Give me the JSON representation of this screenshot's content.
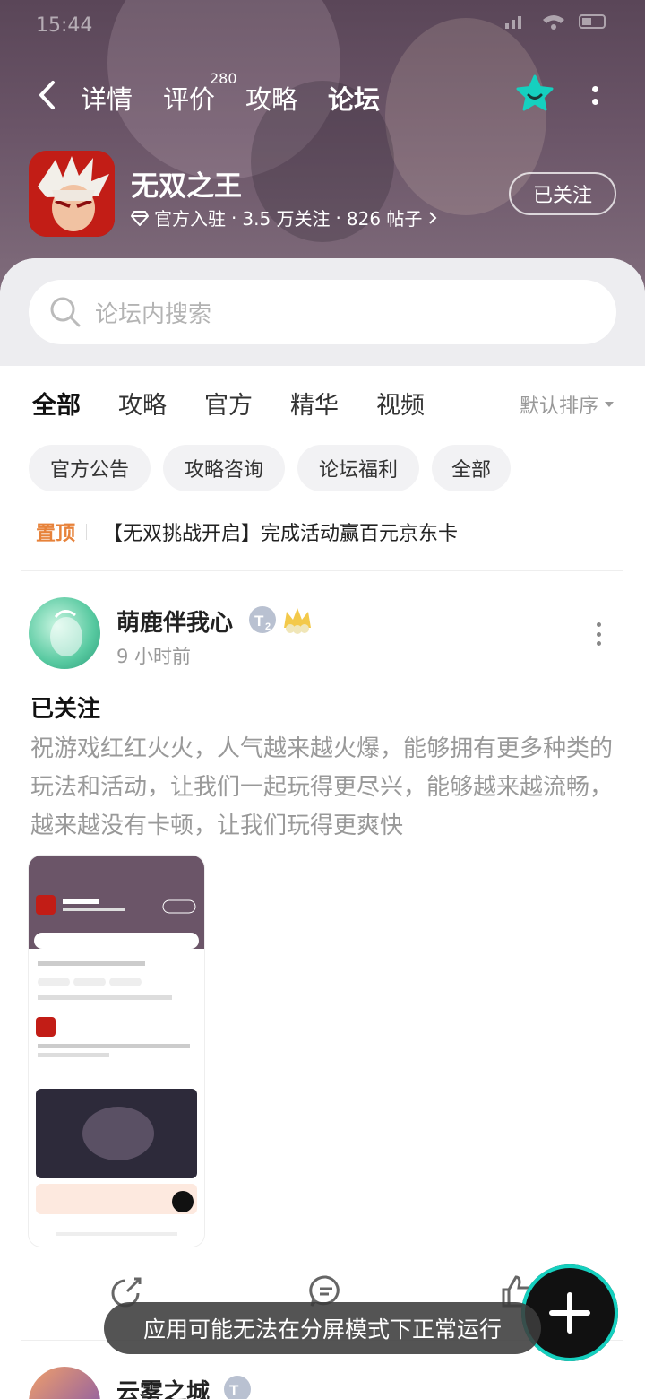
{
  "status_bar": {
    "time": "15:44"
  },
  "nav": {
    "tabs": [
      {
        "label": "详情"
      },
      {
        "label": "评价",
        "badge": "280"
      },
      {
        "label": "攻略"
      },
      {
        "label": "论坛"
      }
    ]
  },
  "game": {
    "name": "无双之王",
    "verified": "官方入驻",
    "followers": "3.5 万关注",
    "posts": "826 帖子",
    "separator": "·",
    "follow_button": "已关注"
  },
  "search": {
    "placeholder": "论坛内搜索"
  },
  "filter_tabs": [
    {
      "label": "全部"
    },
    {
      "label": "攻略"
    },
    {
      "label": "官方"
    },
    {
      "label": "精华"
    },
    {
      "label": "视频"
    }
  ],
  "sort_label": "默认排序",
  "chips": [
    {
      "label": "官方公告"
    },
    {
      "label": "攻略咨询"
    },
    {
      "label": "论坛福利"
    },
    {
      "label": "全部"
    }
  ],
  "pinned": {
    "tag": "置顶",
    "text": "【无双挑战开启】完成活动赢百元京东卡"
  },
  "post": {
    "author": "萌鹿伴我心",
    "time": "9 小时前",
    "title": "已关注",
    "body": "祝游戏红红火火，人气越来越火爆，能够拥有更多种类的玩法和活动，让我们一起玩得更尽兴，能够越来越流畅，越来越没有卡顿，让我们玩得更爽快"
  },
  "toast": "应用可能无法在分屏模式下正常运行",
  "post2": {
    "author": "云雾之城"
  },
  "colors": {
    "accent": "#15d0bf",
    "pinned": "#e7823a"
  }
}
